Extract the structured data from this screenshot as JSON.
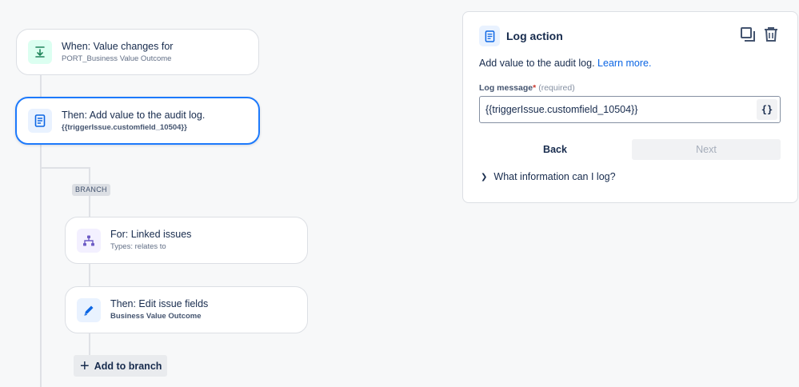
{
  "flow": {
    "trigger": {
      "title": "When: Value changes for",
      "subtitle": "PORT_Business Value Outcome"
    },
    "log_action": {
      "title": "Then: Add value to the audit log.",
      "subtitle": "{{triggerIssue.customfield_10504}}"
    },
    "branch_label": "BRANCH",
    "branch_rule": {
      "title": "For: Linked issues",
      "subtitle": "Types: relates to"
    },
    "edit_action": {
      "title": "Then: Edit issue fields",
      "subtitle": "Business Value Outcome"
    },
    "add_to_branch": "Add to branch"
  },
  "panel": {
    "title": "Log action",
    "description": "Add value to the audit log.",
    "learn_more": "Learn more.",
    "field_label": "Log message",
    "required_marker": "*",
    "required_text": "(required)",
    "field_value": "{{triggerIssue.customfield_10504}}",
    "smart_value_label": "{}",
    "back_label": "Back",
    "next_label": "Next",
    "expander_label": "What information can I log?"
  },
  "colors": {
    "accent": "#1d7afc",
    "trigger_icon_bg": "#dcfff1",
    "action_icon_bg": "#e9f2ff",
    "branch_icon_bg": "#f3f0ff"
  },
  "icons": {
    "trigger": "trigger-download-icon",
    "log": "document-icon",
    "branch": "hierarchy-icon",
    "edit": "pencil-icon",
    "duplicate": "copy-icon",
    "delete": "trash-icon"
  }
}
